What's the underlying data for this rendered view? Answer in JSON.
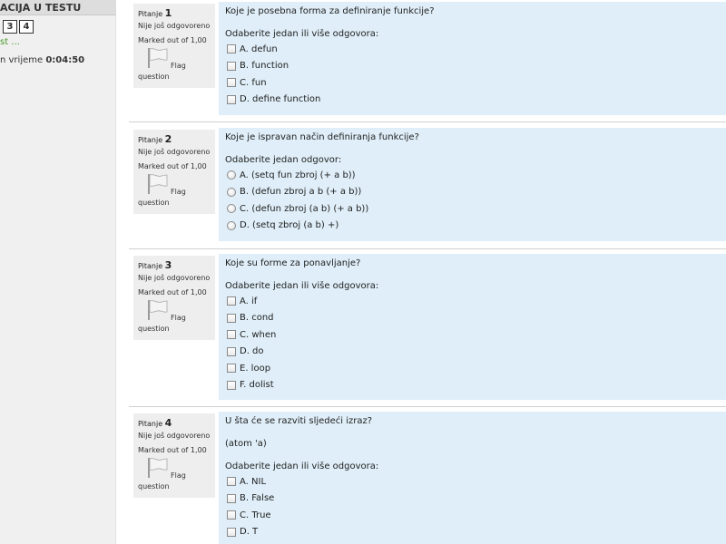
{
  "nav": {
    "title": "ACIJA U TESTU",
    "buttons": [
      "3",
      "4"
    ],
    "finish_link": "st ...",
    "timer_label": "n vrijeme",
    "timer_value": "0:04:50"
  },
  "question_label": "Pitanje",
  "questions": [
    {
      "number": "1",
      "state": "Nije još odgovoreno",
      "grade": "Marked out of 1,00",
      "flag_label_1": "Flag",
      "flag_label_2": "question",
      "text": "Koje je posebna forma za definiranje funkcije?",
      "prompt": "Odaberite jedan ili više odgovora:",
      "input_type": "checkbox",
      "options": [
        "A. defun",
        "B. function",
        "C. fun",
        "D. define function"
      ]
    },
    {
      "number": "2",
      "state": "Nije još odgovoreno",
      "grade": "Marked out of 1,00",
      "flag_label_1": "Flag",
      "flag_label_2": "question",
      "text": "Koje je ispravan način definiranja funkcije?",
      "prompt": "Odaberite jedan odgovor:",
      "input_type": "radio",
      "options": [
        "A. (setq fun zbroj (+ a b))",
        "B. (defun zbroj a b (+ a b))",
        "C. (defun zbroj (a b) (+ a b))",
        "D. (setq zbroj (a b) +)"
      ]
    },
    {
      "number": "3",
      "state": "Nije još odgovoreno",
      "grade": "Marked out of 1,00",
      "flag_label_1": "Flag",
      "flag_label_2": "question",
      "text": "Koje su forme za ponavljanje?",
      "prompt": "Odaberite jedan ili više odgovora:",
      "input_type": "checkbox",
      "options": [
        "A. if",
        "B. cond",
        "C. when",
        "D. do",
        "E. loop",
        "F. dolist"
      ]
    },
    {
      "number": "4",
      "state": "Nije još odgovoreno",
      "grade": "Marked out of 1,00",
      "flag_label_1": "Flag",
      "flag_label_2": "question",
      "text": "U šta će se razviti sljedeći izraz?",
      "text2": "(atom 'a)",
      "prompt": "Odaberite jedan ili više odgovora:",
      "input_type": "checkbox",
      "options": [
        "A. NIL",
        "B. False",
        "C. True",
        "D. T"
      ]
    }
  ]
}
